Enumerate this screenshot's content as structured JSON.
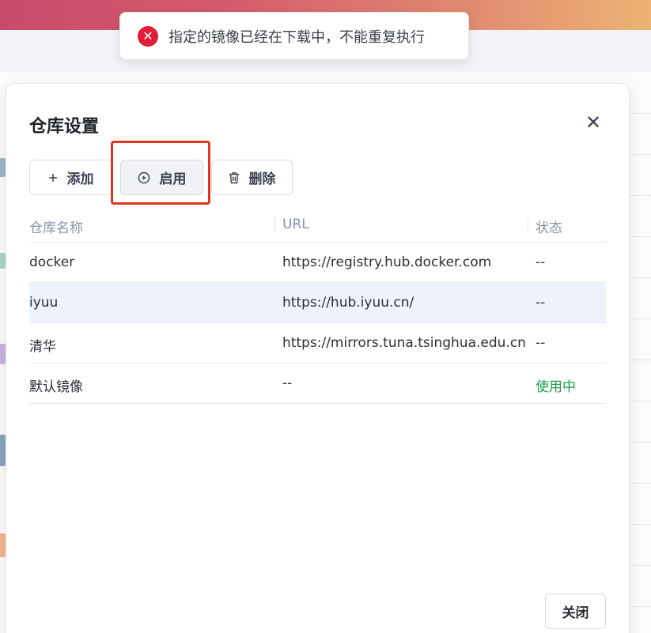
{
  "toast": {
    "icon": "error-circle-icon",
    "message": "指定的镜像已经在下载中，不能重复执行",
    "color": "#e11d3a"
  },
  "dialog": {
    "title": "仓库设置",
    "close_icon": "close-icon",
    "toolbar": {
      "add_label": "添加",
      "enable_label": "启用",
      "delete_label": "删除"
    },
    "table": {
      "columns": [
        "仓库名称",
        "URL",
        "状态"
      ],
      "rows": [
        {
          "name": "docker",
          "url": "https://registry.hub.docker.com",
          "status": "--"
        },
        {
          "name": "iyuu",
          "url": "https://hub.iyuu.cn/",
          "status": "--"
        },
        {
          "name": "清华",
          "url": "https://mirrors.tuna.tsinghua.edu.cn",
          "status": "--"
        },
        {
          "name": "默认镜像",
          "url": "--",
          "status": "使用中"
        }
      ],
      "selected_row": "iyuu",
      "active_status_color": "#1ca14a"
    },
    "footer": {
      "close_label": "关闭"
    }
  },
  "annotation": {
    "highlight_color": "#e0351f"
  }
}
